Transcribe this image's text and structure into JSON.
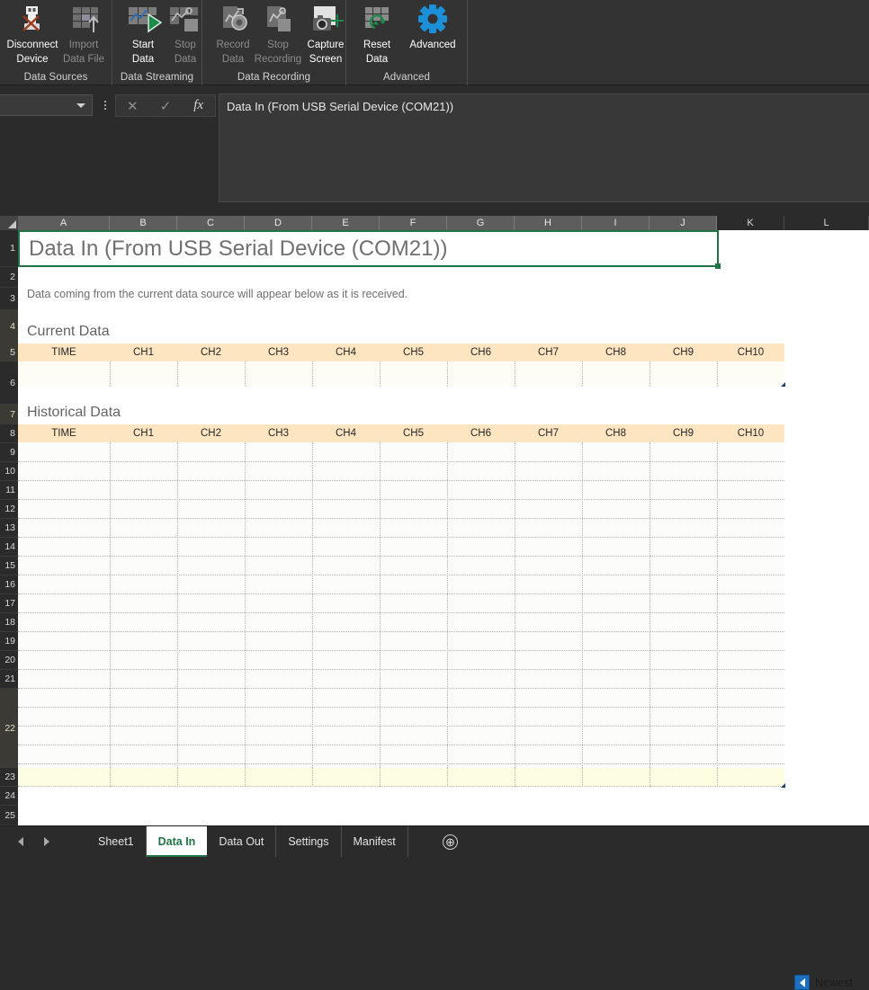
{
  "ribbon": {
    "groups": [
      {
        "caption": "Data Sources",
        "buttons": [
          {
            "label_l1": "Disconnect",
            "label_l2": "Device",
            "icon": "usb-disconnect-icon",
            "enabled": true
          },
          {
            "label_l1": "Import",
            "label_l2": "Data File",
            "icon": "import-data-file-icon",
            "enabled": false
          }
        ]
      },
      {
        "caption": "Data Streaming",
        "buttons": [
          {
            "label_l1": "Start",
            "label_l2": "Data",
            "icon": "start-data-icon",
            "enabled": true
          },
          {
            "label_l1": "Stop",
            "label_l2": "Data",
            "icon": "stop-data-icon",
            "enabled": false
          }
        ]
      },
      {
        "caption": "Data Recording",
        "buttons": [
          {
            "label_l1": "Record",
            "label_l2": "Data",
            "icon": "record-data-icon",
            "enabled": false
          },
          {
            "label_l1": "Stop",
            "label_l2": "Recording",
            "icon": "stop-recording-icon",
            "enabled": false
          },
          {
            "label_l1": "Capture",
            "label_l2": "Screen",
            "icon": "capture-screen-icon",
            "enabled": true
          }
        ]
      },
      {
        "caption": "Advanced",
        "buttons": [
          {
            "label_l1": "Reset",
            "label_l2": "Data",
            "icon": "reset-data-icon",
            "enabled": true
          },
          {
            "label_l1": "Advanced",
            "label_l2": "",
            "icon": "gear-icon",
            "enabled": true
          }
        ]
      }
    ]
  },
  "formula_bar": {
    "name_box_value": "",
    "cancel_icon": "close-icon",
    "confirm_icon": "check-icon",
    "function_icon": "fx-icon",
    "formula_value": "Data In (From USB Serial Device (COM21))"
  },
  "grid": {
    "columns": [
      "A",
      "B",
      "C",
      "D",
      "E",
      "F",
      "G",
      "H",
      "I",
      "J",
      "K",
      "L"
    ],
    "selected_columns": [
      "A",
      "B",
      "C",
      "D",
      "E",
      "F",
      "G",
      "H",
      "I",
      "J"
    ],
    "rows": [
      1,
      2,
      3,
      4,
      5,
      6,
      7,
      8,
      9,
      10,
      11,
      12,
      13,
      14,
      15,
      16,
      17,
      18,
      19,
      20,
      21,
      22,
      23,
      24,
      25
    ],
    "tinted_rows": [
      4,
      5,
      7,
      22
    ],
    "active_cell_text": "Data In (From USB Serial Device (COM21))",
    "description_text": "Data coming from the current data source will appear below as it is received.",
    "current_data_label": "Current Data",
    "historical_data_label": "Historical Data",
    "table_headers": [
      "TIME",
      "CH1",
      "CH2",
      "CH3",
      "CH4",
      "CH5",
      "CH6",
      "CH7",
      "CH8",
      "CH9",
      "CH10"
    ],
    "newest_label": "Newest",
    "newest_icon": "left-triangle-icon"
  },
  "sheet_tabs": {
    "prev_icon": "nav-prev-icon",
    "next_icon": "nav-next-icon",
    "tabs": [
      {
        "label": "Sheet1",
        "active": false
      },
      {
        "label": "Data In",
        "active": true
      },
      {
        "label": "Data Out",
        "active": false
      },
      {
        "label": "Settings",
        "active": false
      },
      {
        "label": "Manifest",
        "active": false
      }
    ],
    "add_sheet_label": "⊕"
  },
  "colors": {
    "accent_green": "#217346",
    "table_header": "#fce5c0",
    "table_body": "#fdfdf6",
    "newest_blue": "#1d6fc0",
    "ribbon_bg": "#333333"
  }
}
